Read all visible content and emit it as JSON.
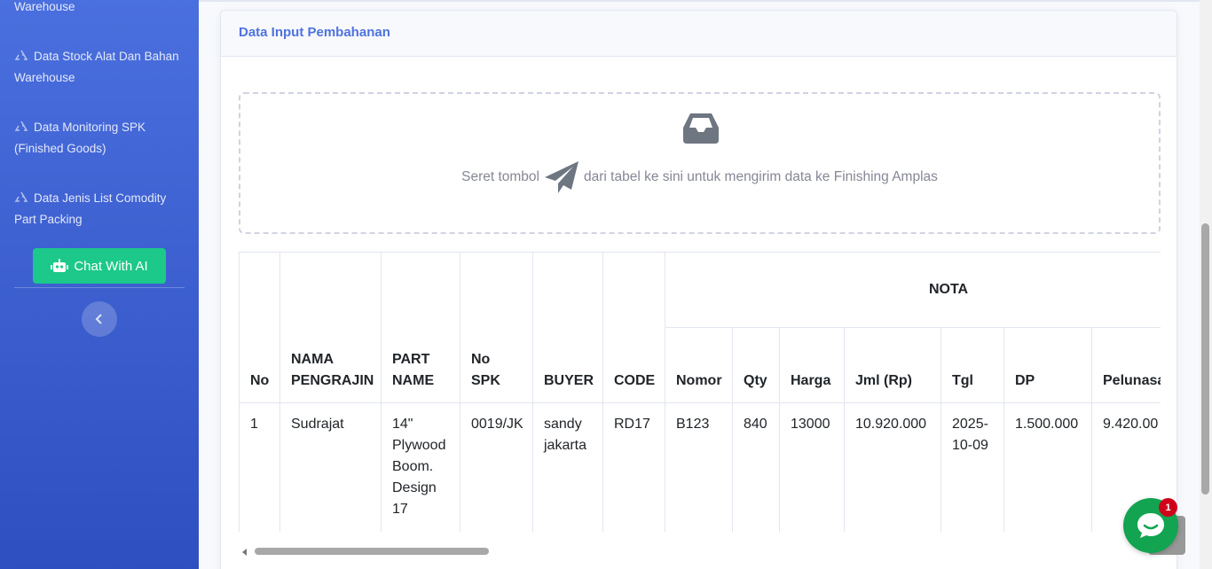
{
  "sidebar": {
    "items": [
      {
        "label": "Warehouse"
      },
      {
        "label": "Data Stock Alat Dan Bahan Warehouse"
      },
      {
        "label": "Data Monitoring SPK (Finished Goods)"
      },
      {
        "label": "Data Jenis List Comodity Part Packing"
      }
    ],
    "chat_button": "Chat With AI"
  },
  "card": {
    "title": "Data Input Pembahanan",
    "drop_text_before": "Seret tombol",
    "drop_text_after": "dari tabel ke sini untuk mengirim data ke Finishing Amplas"
  },
  "table": {
    "group_header": "NOTA",
    "headers": {
      "no": "No",
      "pengrajin": "NAMA PENGRAJIN",
      "part_name": "PART NAME",
      "no_spk": "No SPK",
      "buyer": "BUYER",
      "code": "CODE",
      "nomor": "Nomor",
      "qty": "Qty",
      "harga": "Harga",
      "jml": "Jml (Rp)",
      "tgl": "Tgl",
      "dp": "DP",
      "pelunasan": "Pelunasa"
    },
    "rows": [
      {
        "no": "1",
        "pengrajin": "Sudrajat",
        "part_name": "14\" Plywood Boom. Design 17",
        "no_spk": "0019/JK",
        "buyer": "sandy jakarta",
        "code": "RD17",
        "nomor": "B123",
        "qty": "840",
        "harga": "13000",
        "jml": "10.920.000",
        "tgl": "2025-10-09",
        "dp": "1.500.000",
        "pelunasan": "9.420.00"
      }
    ]
  },
  "chat_widget": {
    "badge": "1"
  },
  "colors": {
    "sidebar": "#4a6fde",
    "accent": "#4e73df",
    "chat_button": "#1cc88a",
    "chat_bubble": "#12a450",
    "badge": "#d0021b"
  }
}
